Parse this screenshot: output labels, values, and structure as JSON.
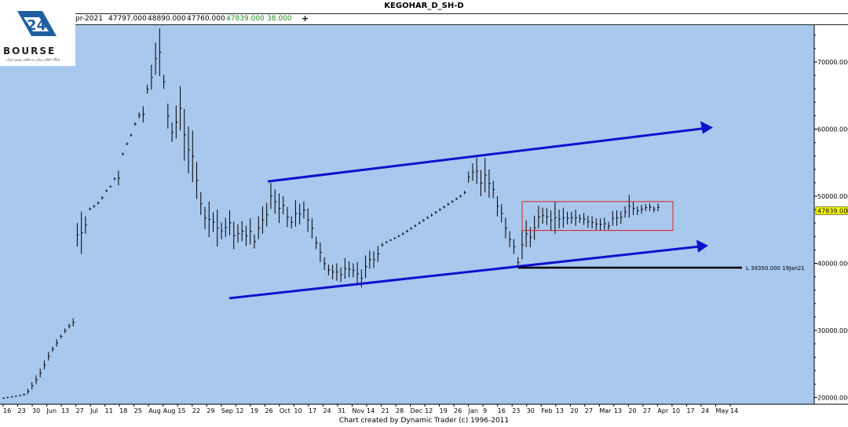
{
  "title": "KEGOHAR_D_SH-D",
  "ohlc": {
    "date_partial": "pr-2021",
    "open": "47797.000",
    "high": "48890.000",
    "low": "47760.000",
    "close": "47839.000",
    "change": "38.000",
    "plus": "+"
  },
  "logo": {
    "word": "BOURSE",
    "subtitle": "پایگاه اطلاع رسانی و تحلیلی بورس ایران"
  },
  "footer": "Chart created by Dynamic Trader  (c) 1996-2011",
  "colors": {
    "plot_bg": "#a8c8ee",
    "trend": "#1010cc",
    "support": "#000000",
    "box": "#e02020",
    "bars": "#000000"
  },
  "chart_data": {
    "type": "ohlc",
    "symbol": "KEGOHAR_D_SH-D",
    "ylim": [
      19000,
      75500
    ],
    "y_ticks": [
      20000,
      30000,
      40000,
      50000,
      60000,
      70000
    ],
    "y_tick_labels": [
      "20000.000",
      "30000.000",
      "40000.000",
      "50000.000",
      "60000.000",
      "70000.000"
    ],
    "last_price_label": "47839.000",
    "x_ticks": [
      "16",
      "23",
      "30",
      "Jun",
      "13",
      "27",
      "Jul",
      "11",
      "18",
      "25",
      "Aug",
      "Aug",
      "15",
      "22",
      "29",
      "Sep",
      "12",
      "19",
      "26",
      "Oct",
      "10",
      "17",
      "24",
      "31",
      "Nov",
      "14",
      "21",
      "28",
      "Dec",
      "12",
      "19",
      "26",
      "Jan",
      "9",
      "16",
      "23",
      "30",
      "Feb",
      "13",
      "20",
      "27",
      "Mar",
      "13",
      "20",
      "27",
      "Apr",
      "10",
      "17",
      "24",
      "May",
      "14"
    ],
    "bars": [
      {
        "h": 20000,
        "l": 19800
      },
      {
        "h": 20100,
        "l": 19900
      },
      {
        "h": 20200,
        "l": 20000
      },
      {
        "h": 20300,
        "l": 20100
      },
      {
        "h": 20400,
        "l": 20200
      },
      {
        "h": 20600,
        "l": 20300
      },
      {
        "h": 21300,
        "l": 20500
      },
      {
        "h": 22300,
        "l": 21200
      },
      {
        "h": 23300,
        "l": 22000
      },
      {
        "h": 24300,
        "l": 23000
      },
      {
        "h": 25500,
        "l": 24200
      },
      {
        "h": 26800,
        "l": 25500
      },
      {
        "h": 27600,
        "l": 26800
      },
      {
        "h": 28700,
        "l": 27600
      },
      {
        "h": 29400,
        "l": 28800
      },
      {
        "h": 30300,
        "l": 29600
      },
      {
        "h": 31000,
        "l": 30300
      },
      {
        "h": 31800,
        "l": 30600
      },
      {
        "h": 46000,
        "l": 42500
      },
      {
        "h": 47700,
        "l": 41400
      },
      {
        "h": 47000,
        "l": 44400
      },
      {
        "h": 48300,
        "l": 47900
      },
      {
        "h": 48700,
        "l": 48300
      },
      {
        "h": 49200,
        "l": 48800
      },
      {
        "h": 50000,
        "l": 49500
      },
      {
        "h": 51000,
        "l": 50600
      },
      {
        "h": 51600,
        "l": 51300
      },
      {
        "h": 52800,
        "l": 52400
      },
      {
        "h": 53800,
        "l": 51600
      },
      {
        "h": 56500,
        "l": 56100
      },
      {
        "h": 58000,
        "l": 57600
      },
      {
        "h": 59300,
        "l": 58900
      },
      {
        "h": 61000,
        "l": 60500
      },
      {
        "h": 62500,
        "l": 61600
      },
      {
        "h": 63400,
        "l": 61000
      },
      {
        "h": 66600,
        "l": 65300
      },
      {
        "h": 69600,
        "l": 65900
      },
      {
        "h": 72900,
        "l": 68100
      },
      {
        "h": 75000,
        "l": 67900
      },
      {
        "h": 68100,
        "l": 66000
      },
      {
        "h": 63800,
        "l": 60100
      },
      {
        "h": 61000,
        "l": 58100
      },
      {
        "h": 63500,
        "l": 58600
      },
      {
        "h": 66400,
        "l": 59800
      },
      {
        "h": 63000,
        "l": 55300
      },
      {
        "h": 60400,
        "l": 53400
      },
      {
        "h": 59800,
        "l": 52100
      },
      {
        "h": 55100,
        "l": 49600
      },
      {
        "h": 50600,
        "l": 47200
      },
      {
        "h": 48400,
        "l": 45100
      },
      {
        "h": 49200,
        "l": 43900
      },
      {
        "h": 47600,
        "l": 44700
      },
      {
        "h": 48000,
        "l": 42500
      },
      {
        "h": 46100,
        "l": 43600
      },
      {
        "h": 46800,
        "l": 43900
      },
      {
        "h": 47900,
        "l": 44200
      },
      {
        "h": 46200,
        "l": 42100
      },
      {
        "h": 45800,
        "l": 43100
      },
      {
        "h": 46300,
        "l": 43300
      },
      {
        "h": 45600,
        "l": 42600
      },
      {
        "h": 46700,
        "l": 42800
      },
      {
        "h": 44300,
        "l": 42200
      },
      {
        "h": 47000,
        "l": 43600
      },
      {
        "h": 48500,
        "l": 44400
      },
      {
        "h": 49000,
        "l": 45500
      },
      {
        "h": 52000,
        "l": 48100
      },
      {
        "h": 51000,
        "l": 47400
      },
      {
        "h": 50400,
        "l": 46000
      },
      {
        "h": 50000,
        "l": 47300
      },
      {
        "h": 48400,
        "l": 45400
      },
      {
        "h": 47000,
        "l": 45200
      },
      {
        "h": 49400,
        "l": 45500
      },
      {
        "h": 48900,
        "l": 45800
      },
      {
        "h": 49200,
        "l": 46700
      },
      {
        "h": 48200,
        "l": 44700
      },
      {
        "h": 46700,
        "l": 43700
      },
      {
        "h": 44000,
        "l": 42100
      },
      {
        "h": 43100,
        "l": 40200
      },
      {
        "h": 40900,
        "l": 39000
      },
      {
        "h": 39800,
        "l": 38200
      },
      {
        "h": 39800,
        "l": 37600
      },
      {
        "h": 40000,
        "l": 37400
      },
      {
        "h": 39400,
        "l": 37200
      },
      {
        "h": 40800,
        "l": 37700
      },
      {
        "h": 40300,
        "l": 37900
      },
      {
        "h": 40000,
        "l": 37900
      },
      {
        "h": 40200,
        "l": 36700
      },
      {
        "h": 39100,
        "l": 36400
      },
      {
        "h": 41200,
        "l": 37800
      },
      {
        "h": 41900,
        "l": 39200
      },
      {
        "h": 41800,
        "l": 39300
      },
      {
        "h": 42600,
        "l": 40200
      },
      {
        "h": 43000,
        "l": 42500
      },
      {
        "h": 43300,
        "l": 43000
      },
      {
        "h": 43600,
        "l": 43300
      },
      {
        "h": 43900,
        "l": 43600
      },
      {
        "h": 44200,
        "l": 43900
      },
      {
        "h": 44600,
        "l": 44200
      },
      {
        "h": 45000,
        "l": 44600
      },
      {
        "h": 45400,
        "l": 45000
      },
      {
        "h": 45800,
        "l": 45400
      },
      {
        "h": 46200,
        "l": 45800
      },
      {
        "h": 46600,
        "l": 46200
      },
      {
        "h": 47000,
        "l": 46600
      },
      {
        "h": 47400,
        "l": 47000
      },
      {
        "h": 47800,
        "l": 47400
      },
      {
        "h": 48200,
        "l": 47800
      },
      {
        "h": 48600,
        "l": 48200
      },
      {
        "h": 49000,
        "l": 48600
      },
      {
        "h": 49400,
        "l": 49000
      },
      {
        "h": 49800,
        "l": 49400
      },
      {
        "h": 50200,
        "l": 49800
      },
      {
        "h": 50800,
        "l": 50300
      },
      {
        "h": 53700,
        "l": 52000
      },
      {
        "h": 54900,
        "l": 52300
      },
      {
        "h": 55700,
        "l": 51800
      },
      {
        "h": 53900,
        "l": 50000
      },
      {
        "h": 55700,
        "l": 50600
      },
      {
        "h": 54000,
        "l": 49800
      },
      {
        "h": 52300,
        "l": 49700
      },
      {
        "h": 50000,
        "l": 47000
      },
      {
        "h": 48800,
        "l": 46100
      },
      {
        "h": 46800,
        "l": 43700
      },
      {
        "h": 44800,
        "l": 42400
      },
      {
        "h": 43600,
        "l": 41400
      },
      {
        "h": 40900,
        "l": 39350
      },
      {
        "h": 44900,
        "l": 40600
      },
      {
        "h": 46400,
        "l": 42400
      },
      {
        "h": 45400,
        "l": 42400
      },
      {
        "h": 47100,
        "l": 43500
      },
      {
        "h": 48600,
        "l": 45200
      },
      {
        "h": 48300,
        "l": 45900
      },
      {
        "h": 48200,
        "l": 45700
      },
      {
        "h": 47900,
        "l": 44900
      },
      {
        "h": 49200,
        "l": 44400
      },
      {
        "h": 48000,
        "l": 45200
      },
      {
        "h": 48300,
        "l": 45300
      },
      {
        "h": 47700,
        "l": 45800
      },
      {
        "h": 47700,
        "l": 45900
      },
      {
        "h": 48000,
        "l": 45600
      },
      {
        "h": 47300,
        "l": 46000
      },
      {
        "h": 47500,
        "l": 45700
      },
      {
        "h": 47100,
        "l": 45300
      },
      {
        "h": 47000,
        "l": 45200
      },
      {
        "h": 46700,
        "l": 45000
      },
      {
        "h": 46700,
        "l": 44900
      },
      {
        "h": 46800,
        "l": 45000
      },
      {
        "h": 46200,
        "l": 44900
      },
      {
        "h": 47800,
        "l": 45600
      },
      {
        "h": 47900,
        "l": 45600
      },
      {
        "h": 47800,
        "l": 45900
      },
      {
        "h": 48500,
        "l": 46800
      },
      {
        "h": 50200,
        "l": 46800
      },
      {
        "h": 49200,
        "l": 47200
      },
      {
        "h": 48500,
        "l": 47200
      },
      {
        "h": 48700,
        "l": 47400
      },
      {
        "h": 48800,
        "l": 47800
      },
      {
        "h": 48900,
        "l": 47800
      },
      {
        "h": 48500,
        "l": 47600
      },
      {
        "h": 48890,
        "l": 47760
      }
    ],
    "trendlines": [
      {
        "x1": 0.1,
        "y1": 0.0,
        "kind": "upper_channel"
      },
      {
        "x1": 0.1,
        "y1": 0.0,
        "kind": "lower_channel"
      }
    ],
    "support_label": "L 39350.000 19Jan21",
    "support_level": 39350
  }
}
